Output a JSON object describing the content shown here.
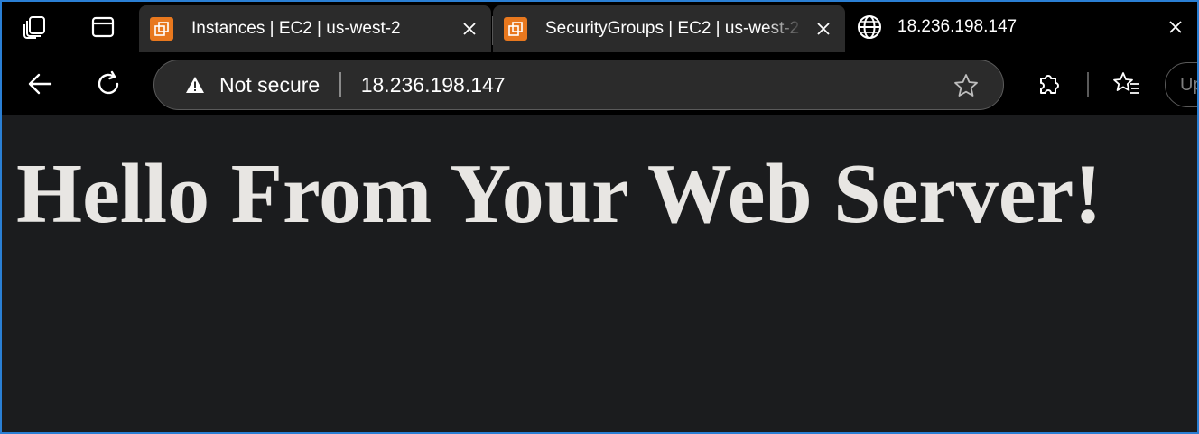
{
  "tabs": [
    {
      "title": "Instances | EC2 | us-west-2",
      "favicon": "aws-ec2-icon",
      "active": false
    },
    {
      "title": "SecurityGroups | EC2 | us-west-2",
      "favicon": "aws-ec2-icon",
      "active": false
    },
    {
      "title": "18.236.198.147",
      "favicon": "globe-icon",
      "active": true
    }
  ],
  "omnibox": {
    "security_label": "Not secure",
    "url": "18.236.198.147"
  },
  "toolbar": {
    "update_label": "Up"
  },
  "page": {
    "heading": "Hello From Your Web Server!"
  },
  "colors": {
    "chrome": "#000000",
    "tab_inactive": "#2b2b2b",
    "page_bg": "#1b1c1e",
    "heading_text": "#e8e6e3",
    "aws_orange": "#e8781e",
    "window_border": "#2a7fd4"
  }
}
